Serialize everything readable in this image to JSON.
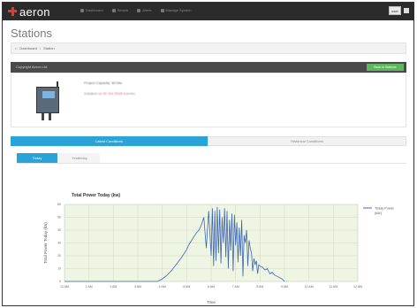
{
  "app": {
    "logo_text": "aeron"
  },
  "nav": {
    "items": [
      {
        "label": "Dashboard",
        "icon": "dashboard-icon"
      },
      {
        "label": "Search",
        "icon": "search-icon"
      },
      {
        "label": "Alerts",
        "icon": "alert-icon"
      },
      {
        "label": "Manage System",
        "icon": "settings-icon"
      }
    ],
    "user_label": "user"
  },
  "page": {
    "title": "Stations",
    "breadcrumb": [
      "Dashboard",
      "Station"
    ]
  },
  "station": {
    "panel_title": "Copyright Aeron Ltd",
    "edit_label": "Back to Stations",
    "info_line1": "Project Capacity: 80 Mw",
    "info_line2_pre": "Installed on ",
    "info_line2_red": "01 Oct 2015",
    "info_line2_post": " Inverter"
  },
  "tabs": {
    "main": [
      "Latest Conditions",
      "Historical Conditions"
    ],
    "sub": [
      "Today",
      "Yesterday"
    ]
  },
  "colors": {
    "accent": "#29a3d8",
    "nav_bg": "#2b2b2b",
    "success": "#5cb85c",
    "line": "#3d66b4",
    "plot_bg": "#eef5e2"
  },
  "chart_data": {
    "type": "line",
    "title": "Total Power Today (kw)",
    "xlabel": "Time",
    "ylabel": "Total Power Today (kw)",
    "ylim": [
      0,
      60
    ],
    "yticks": [
      0,
      10,
      20,
      30,
      40,
      50,
      60
    ],
    "xticks": [
      "12 AM",
      "1 AM",
      "2 AM",
      "3 AM",
      "4 AM",
      "5 AM",
      "6 AM",
      "7 AM",
      "8 AM",
      "9 AM",
      "10 AM",
      "11 AM",
      "12 AM"
    ],
    "xlim": [
      0,
      12
    ],
    "grid": true,
    "legend_position": "right",
    "series": [
      {
        "name": "Today Power (kW)",
        "x": [
          0,
          0.5,
          1,
          1.5,
          2,
          2.5,
          3,
          3.5,
          3.8,
          4.0,
          4.2,
          4.4,
          4.6,
          4.8,
          5.0,
          5.1,
          5.2,
          5.3,
          5.4,
          5.5,
          5.6,
          5.7,
          5.8,
          5.9,
          6.0,
          6.05,
          6.1,
          6.15,
          6.2,
          6.25,
          6.3,
          6.35,
          6.4,
          6.45,
          6.5,
          6.55,
          6.6,
          6.65,
          6.7,
          6.75,
          6.8,
          6.85,
          6.9,
          6.95,
          7.0,
          7.05,
          7.1,
          7.15,
          7.2,
          7.25,
          7.3,
          7.35,
          7.4,
          7.45,
          7.5,
          7.55,
          7.6,
          7.65,
          7.7,
          7.75,
          7.8,
          7.85,
          7.9,
          7.95,
          8.0,
          8.1,
          8.2,
          8.3,
          8.4,
          8.5,
          8.6,
          8.7,
          8.8,
          8.9,
          9.0
        ],
        "y": [
          0,
          0,
          0,
          0,
          0,
          0,
          0,
          0,
          0,
          2,
          5,
          9,
          14,
          19,
          25,
          29,
          32,
          35,
          38,
          40,
          44,
          50,
          26,
          55,
          20,
          57,
          12,
          55,
          16,
          58,
          22,
          56,
          14,
          50,
          30,
          57,
          19,
          55,
          10,
          48,
          24,
          53,
          8,
          52,
          28,
          46,
          15,
          42,
          20,
          48,
          4,
          36,
          30,
          40,
          12,
          32,
          26,
          22,
          8,
          18,
          13,
          16,
          6,
          13,
          12,
          11,
          9,
          10,
          6,
          7,
          5,
          4,
          3,
          2,
          0
        ]
      }
    ]
  }
}
